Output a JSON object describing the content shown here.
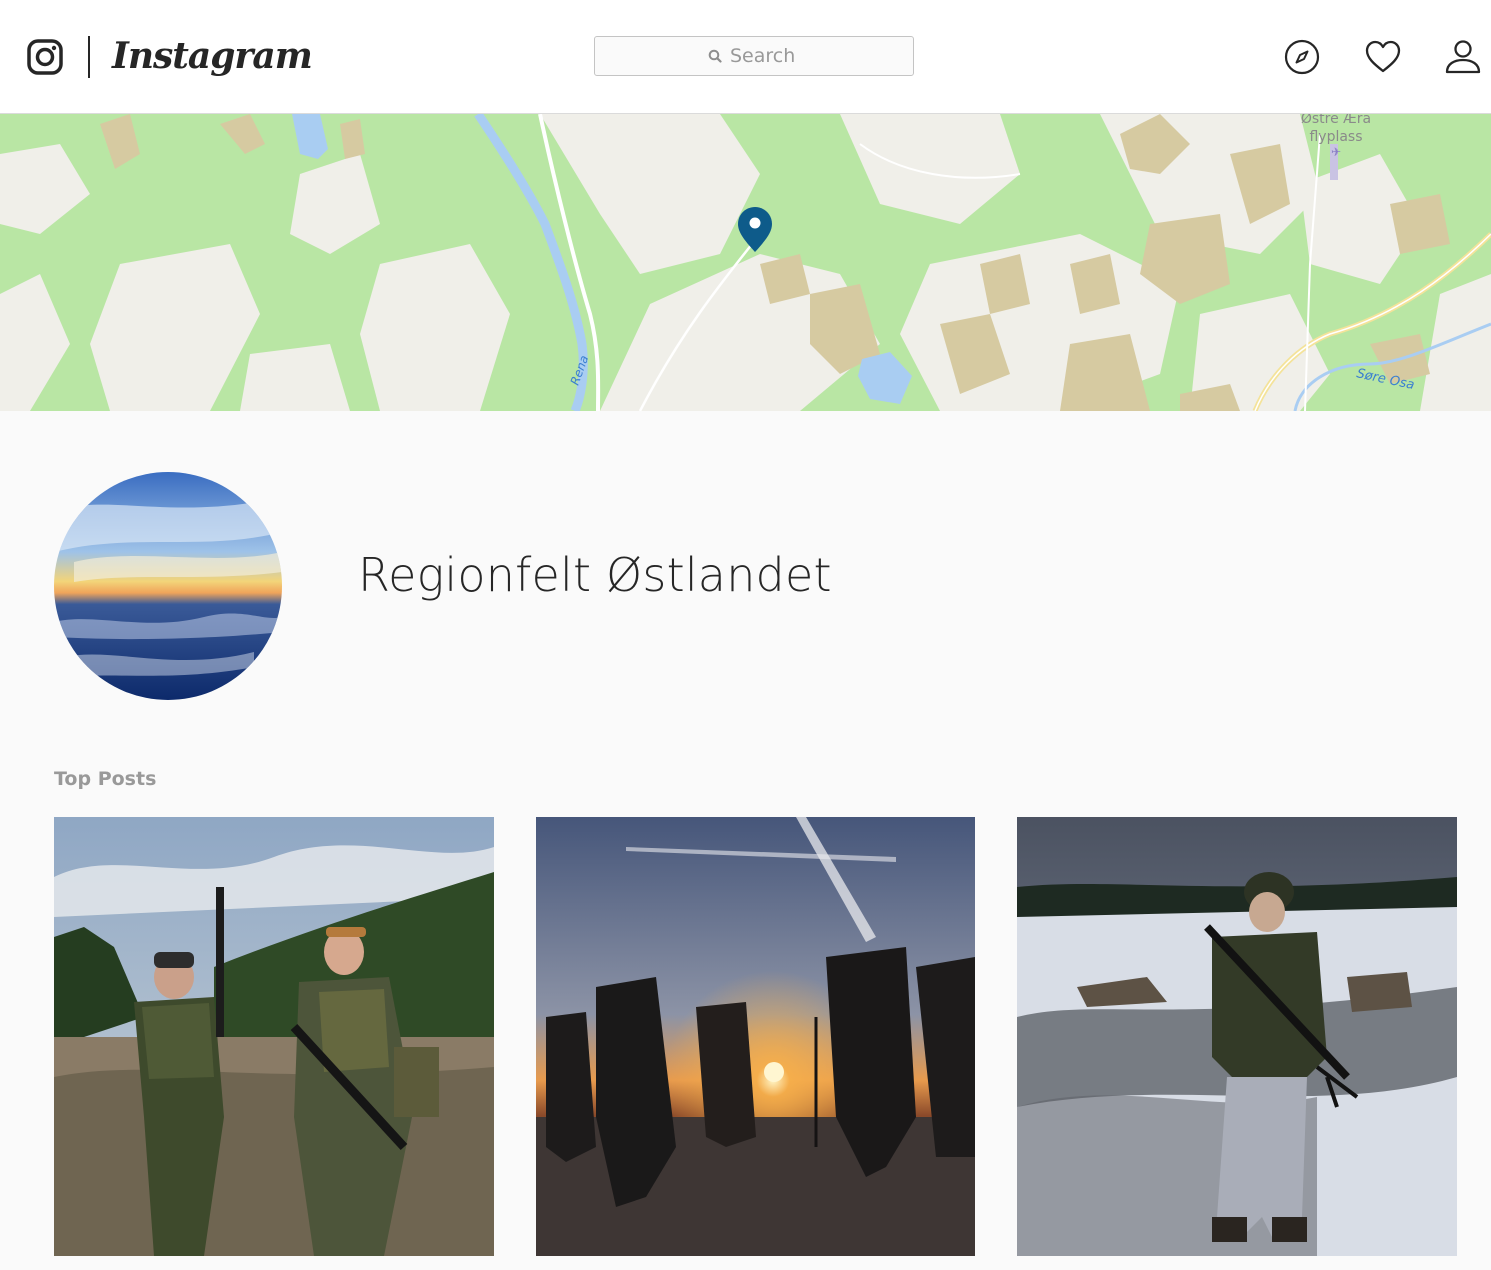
{
  "header": {
    "brand": "Instagram",
    "search": {
      "placeholder": "Search",
      "value": ""
    },
    "icons": [
      "instagram-camera-icon",
      "search-icon",
      "compass-icon",
      "heart-icon",
      "person-icon"
    ]
  },
  "map": {
    "labels": {
      "airfield_line1": "Østre Æra",
      "airfield_line2": "flyplass",
      "river_west": "Rena",
      "river_east": "Søre Osa"
    },
    "marker_color": "#0e5b8a"
  },
  "location": {
    "name": "Regionfelt Østlandet"
  },
  "sections": {
    "top_posts_label": "Top Posts"
  },
  "posts": [
    {
      "alt": "two-soldiers-with-rifles"
    },
    {
      "alt": "soldiers-silhouette-at-sunrise"
    },
    {
      "alt": "soldier-in-snow-with-machine-gun"
    }
  ]
}
